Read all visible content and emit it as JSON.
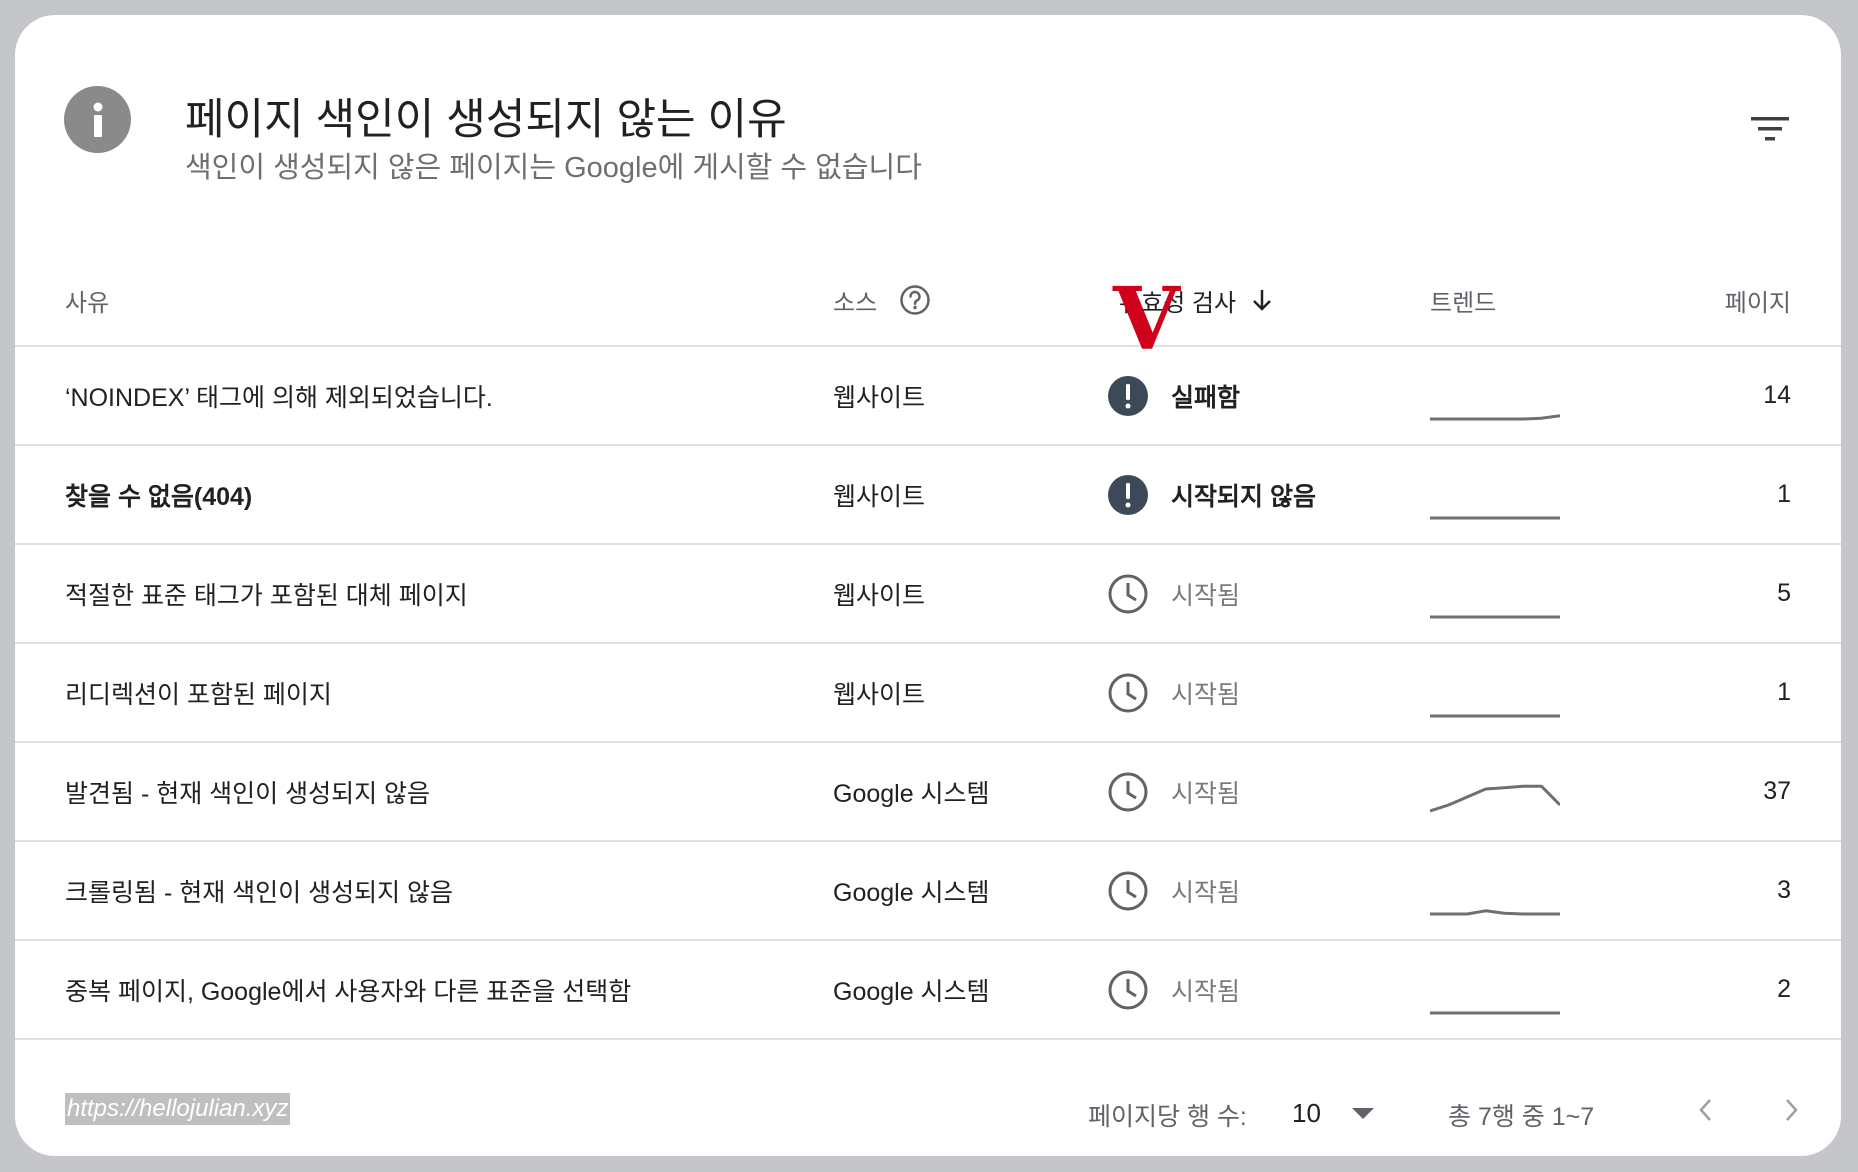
{
  "header": {
    "title": "페이지 색인이 생성되지 않는 이유",
    "subtitle": "색인이 생성되지 않은 페이지는 Google에 게시할 수 없습니다"
  },
  "columns": {
    "reason": "사유",
    "source": "소스",
    "validation": "유효성 검사",
    "trend": "트렌드",
    "pages": "페이지"
  },
  "annotation": "V",
  "rows": [
    {
      "reason": "‘NOINDEX’ 태그에 의해 제외되었습니다.",
      "source": "웹사이트",
      "status": "실패함",
      "status_type": "fail",
      "pages": "14",
      "trend": [
        0.1,
        0.1,
        0.1,
        0.1,
        0.1,
        0.1,
        0.12,
        0.18
      ],
      "bold": false
    },
    {
      "reason": "찾을 수 없음(404)",
      "source": "웹사이트",
      "status": "시작되지 않음",
      "status_type": "fail",
      "pages": "1",
      "trend": [
        0.1,
        0.1,
        0.1,
        0.1,
        0.1,
        0.1,
        0.1,
        0.1
      ],
      "bold": true
    },
    {
      "reason": "적절한 표준 태그가 포함된 대체 페이지",
      "source": "웹사이트",
      "status": "시작됨",
      "status_type": "started",
      "pages": "5",
      "trend": [
        0.1,
        0.1,
        0.1,
        0.1,
        0.1,
        0.1,
        0.1,
        0.1
      ],
      "bold": false
    },
    {
      "reason": "리디렉션이 포함된 페이지",
      "source": "웹사이트",
      "status": "시작됨",
      "status_type": "started",
      "pages": "1",
      "trend": [
        0.1,
        0.1,
        0.1,
        0.1,
        0.1,
        0.1,
        0.1,
        0.1
      ],
      "bold": false
    },
    {
      "reason": "발견됨 - 현재 색인이 생성되지 않음",
      "source": "Google 시스템",
      "status": "시작됨",
      "status_type": "started",
      "pages": "37",
      "trend": [
        0.2,
        0.35,
        0.55,
        0.75,
        0.78,
        0.82,
        0.82,
        0.35
      ],
      "bold": false
    },
    {
      "reason": "크롤링됨 - 현재 색인이 생성되지 않음",
      "source": "Google 시스템",
      "status": "시작됨",
      "status_type": "started",
      "pages": "3",
      "trend": [
        0.1,
        0.1,
        0.1,
        0.18,
        0.12,
        0.1,
        0.1,
        0.1
      ],
      "bold": false
    },
    {
      "reason": "중복 페이지, Google에서 사용자와 다른 표준을 선택함",
      "source": "Google 시스템",
      "status": "시작됨",
      "status_type": "started",
      "pages": "2",
      "trend": [
        0.1,
        0.1,
        0.1,
        0.1,
        0.1,
        0.1,
        0.1,
        0.1
      ],
      "bold": false
    }
  ],
  "footer": {
    "rows_per_page_label": "페이지당 행 수:",
    "rows_per_page_value": "10",
    "range_text": "총 7행 중 1~7",
    "watermark": "https://hellojulian.xyz"
  }
}
